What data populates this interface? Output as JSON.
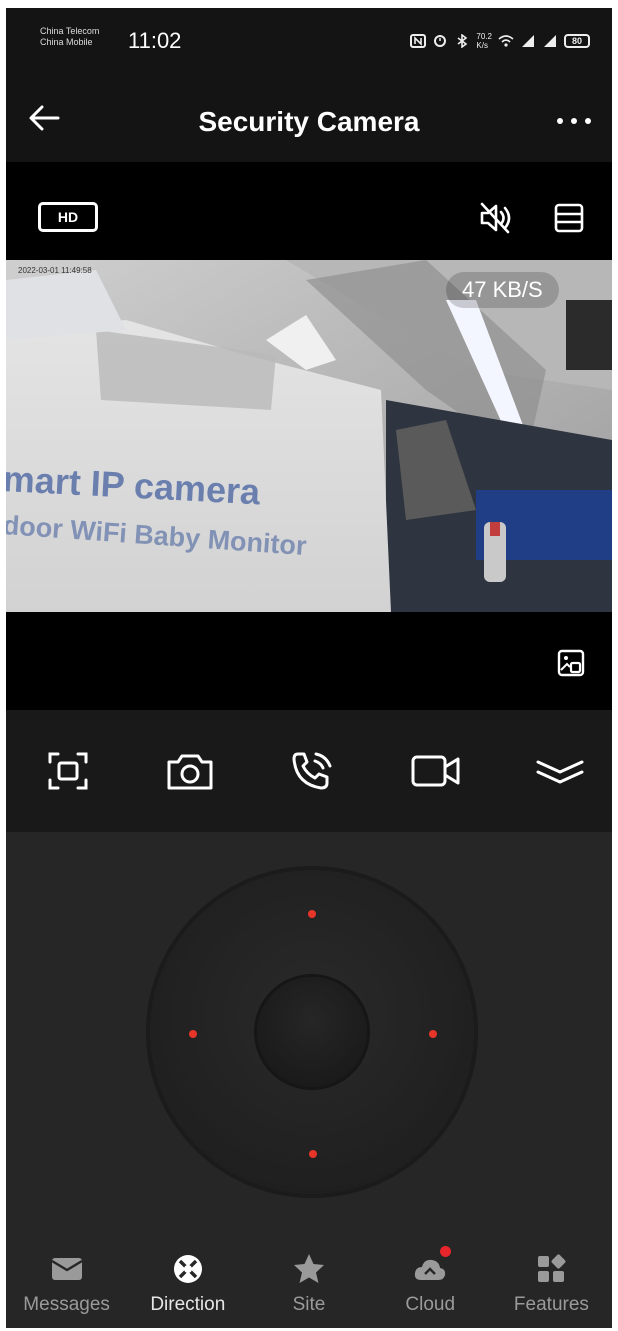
{
  "status_bar": {
    "carrier1": "China Telecom",
    "carrier2": "China Mobile",
    "time": "11:02",
    "net_speed_top": "70.2",
    "net_speed_bottom": "K/s",
    "battery": "80"
  },
  "header": {
    "title": "Security Camera",
    "back_icon": "arrow-left-icon",
    "more_icon": "more-dots-icon"
  },
  "toolbar": {
    "hd_label": "HD",
    "mute_icon": "speaker-muted-icon",
    "layout_icon": "layout-list-icon"
  },
  "video": {
    "speed": "47 KB/S",
    "timestamp": "2022-03-01  11:49:58",
    "visible_text_line1": "mart IP camera",
    "visible_text_line2": "door WiFi Baby Monitor"
  },
  "actions": [
    {
      "name": "screenshot-frame",
      "icon": "frame-capture-icon"
    },
    {
      "name": "snapshot",
      "icon": "camera-icon"
    },
    {
      "name": "talk",
      "icon": "phone-call-icon"
    },
    {
      "name": "record",
      "icon": "video-camera-icon"
    },
    {
      "name": "collapse",
      "icon": "chevron-double-down-icon"
    }
  ],
  "ptz": {
    "accent": "#e8352a",
    "directions": [
      "up",
      "left",
      "right",
      "down"
    ]
  },
  "bottom_nav": {
    "items": [
      {
        "label": "Messages",
        "icon": "envelope-icon"
      },
      {
        "label": "Direction",
        "icon": "direction-pad-icon",
        "active": true
      },
      {
        "label": "Site",
        "icon": "star-icon"
      },
      {
        "label": "Cloud",
        "icon": "cloud-icon",
        "badge": true
      },
      {
        "label": "Features",
        "icon": "grid-icon"
      }
    ]
  }
}
